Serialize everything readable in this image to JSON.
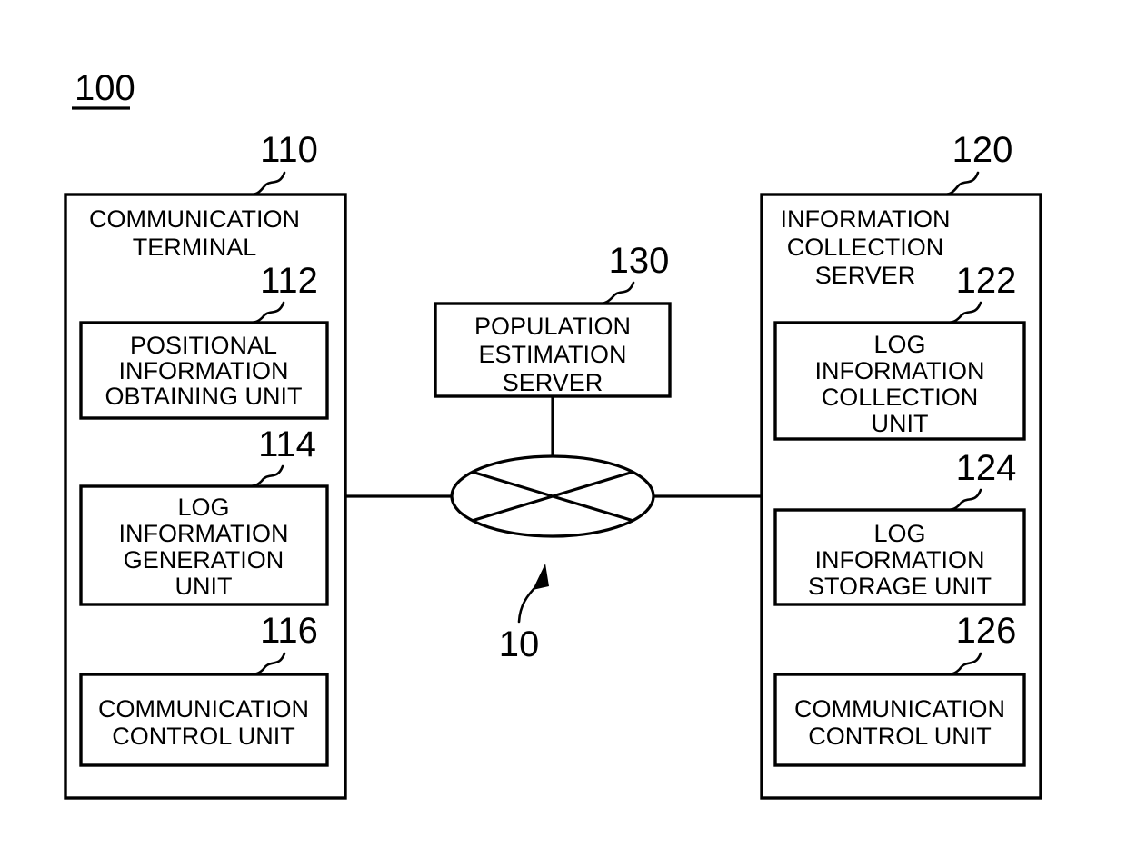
{
  "figure": {
    "system_number": "100",
    "network_number": "10",
    "background_color": "#ffffff",
    "line_color": "#000000"
  },
  "blocks": {
    "communication_terminal": {
      "ref": "110",
      "title_line1": "COMMUNICATION",
      "title_line2": "TERMINAL",
      "units": [
        {
          "ref": "112",
          "lines": [
            "POSITIONAL",
            "INFORMATION",
            "OBTAINING UNIT"
          ]
        },
        {
          "ref": "114",
          "lines": [
            "LOG",
            "INFORMATION",
            "GENERATION",
            "UNIT"
          ]
        },
        {
          "ref": "116",
          "lines": [
            "COMMUNICATION",
            "CONTROL UNIT"
          ]
        }
      ]
    },
    "information_collection_server": {
      "ref": "120",
      "title_line1": "INFORMATION",
      "title_line2": "COLLECTION",
      "title_line3": "SERVER",
      "units": [
        {
          "ref": "122",
          "lines": [
            "LOG",
            "INFORMATION",
            "COLLECTION",
            "UNIT"
          ]
        },
        {
          "ref": "124",
          "lines": [
            "LOG",
            "INFORMATION",
            "STORAGE UNIT"
          ]
        },
        {
          "ref": "126",
          "lines": [
            "COMMUNICATION",
            "CONTROL UNIT"
          ]
        }
      ]
    },
    "population_estimation_server": {
      "ref": "130",
      "lines": [
        "POPULATION",
        "ESTIMATION",
        "SERVER"
      ]
    },
    "network": {
      "ref": "10",
      "icon": "network-cloud-ellipse"
    }
  }
}
